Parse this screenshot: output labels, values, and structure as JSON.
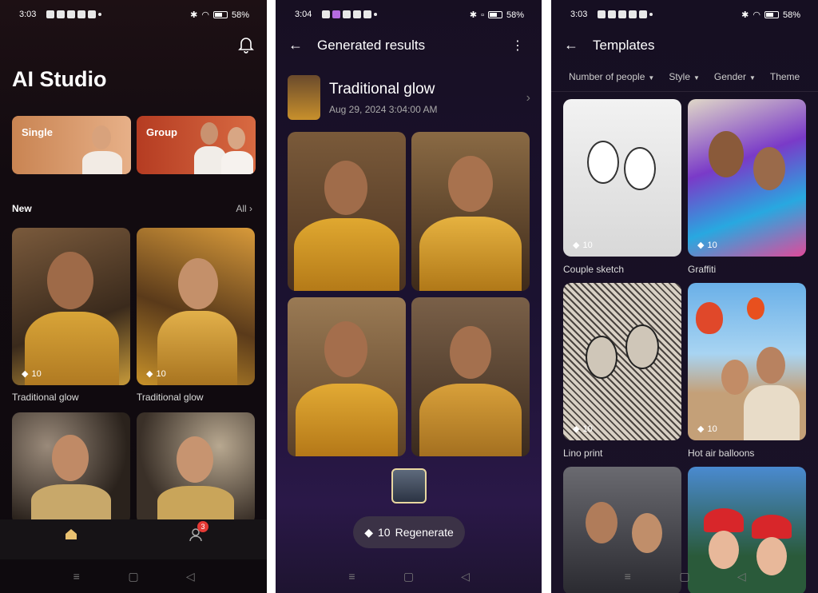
{
  "screen1": {
    "status": {
      "time": "3:03",
      "battery": "58%"
    },
    "title": "AI Studio",
    "modes": [
      {
        "label": "Single"
      },
      {
        "label": "Group"
      }
    ],
    "section": {
      "label": "New",
      "all_label": "All"
    },
    "cards": [
      {
        "caption": "Traditional glow",
        "cost": "10"
      },
      {
        "caption": "Traditional glow",
        "cost": "10"
      }
    ],
    "notification_count": "3"
  },
  "screen2": {
    "status": {
      "time": "3:04",
      "battery": "58%"
    },
    "title": "Generated results",
    "result": {
      "title": "Traditional glow",
      "date": "Aug 29, 2024 3:04:00 AM"
    },
    "regenerate": {
      "cost": "10",
      "label": "Regenerate"
    }
  },
  "screen3": {
    "status": {
      "time": "3:03",
      "battery": "58%"
    },
    "title": "Templates",
    "filters": [
      "Number of people",
      "Style",
      "Gender",
      "Theme"
    ],
    "templates": [
      {
        "caption": "Couple sketch",
        "cost": "10"
      },
      {
        "caption": "Graffiti",
        "cost": "10"
      },
      {
        "caption": "Lino print",
        "cost": "10"
      },
      {
        "caption": "Hot air balloons",
        "cost": "10"
      }
    ]
  },
  "icons": {
    "bell": "bell-icon",
    "back": "arrow-left-icon",
    "more": "more-vert-icon",
    "diamond": "diamond-icon",
    "home": "home-icon",
    "profile": "profile-icon"
  },
  "colors": {
    "accent_gold": "#e8c070",
    "badge_red": "#e53935"
  }
}
